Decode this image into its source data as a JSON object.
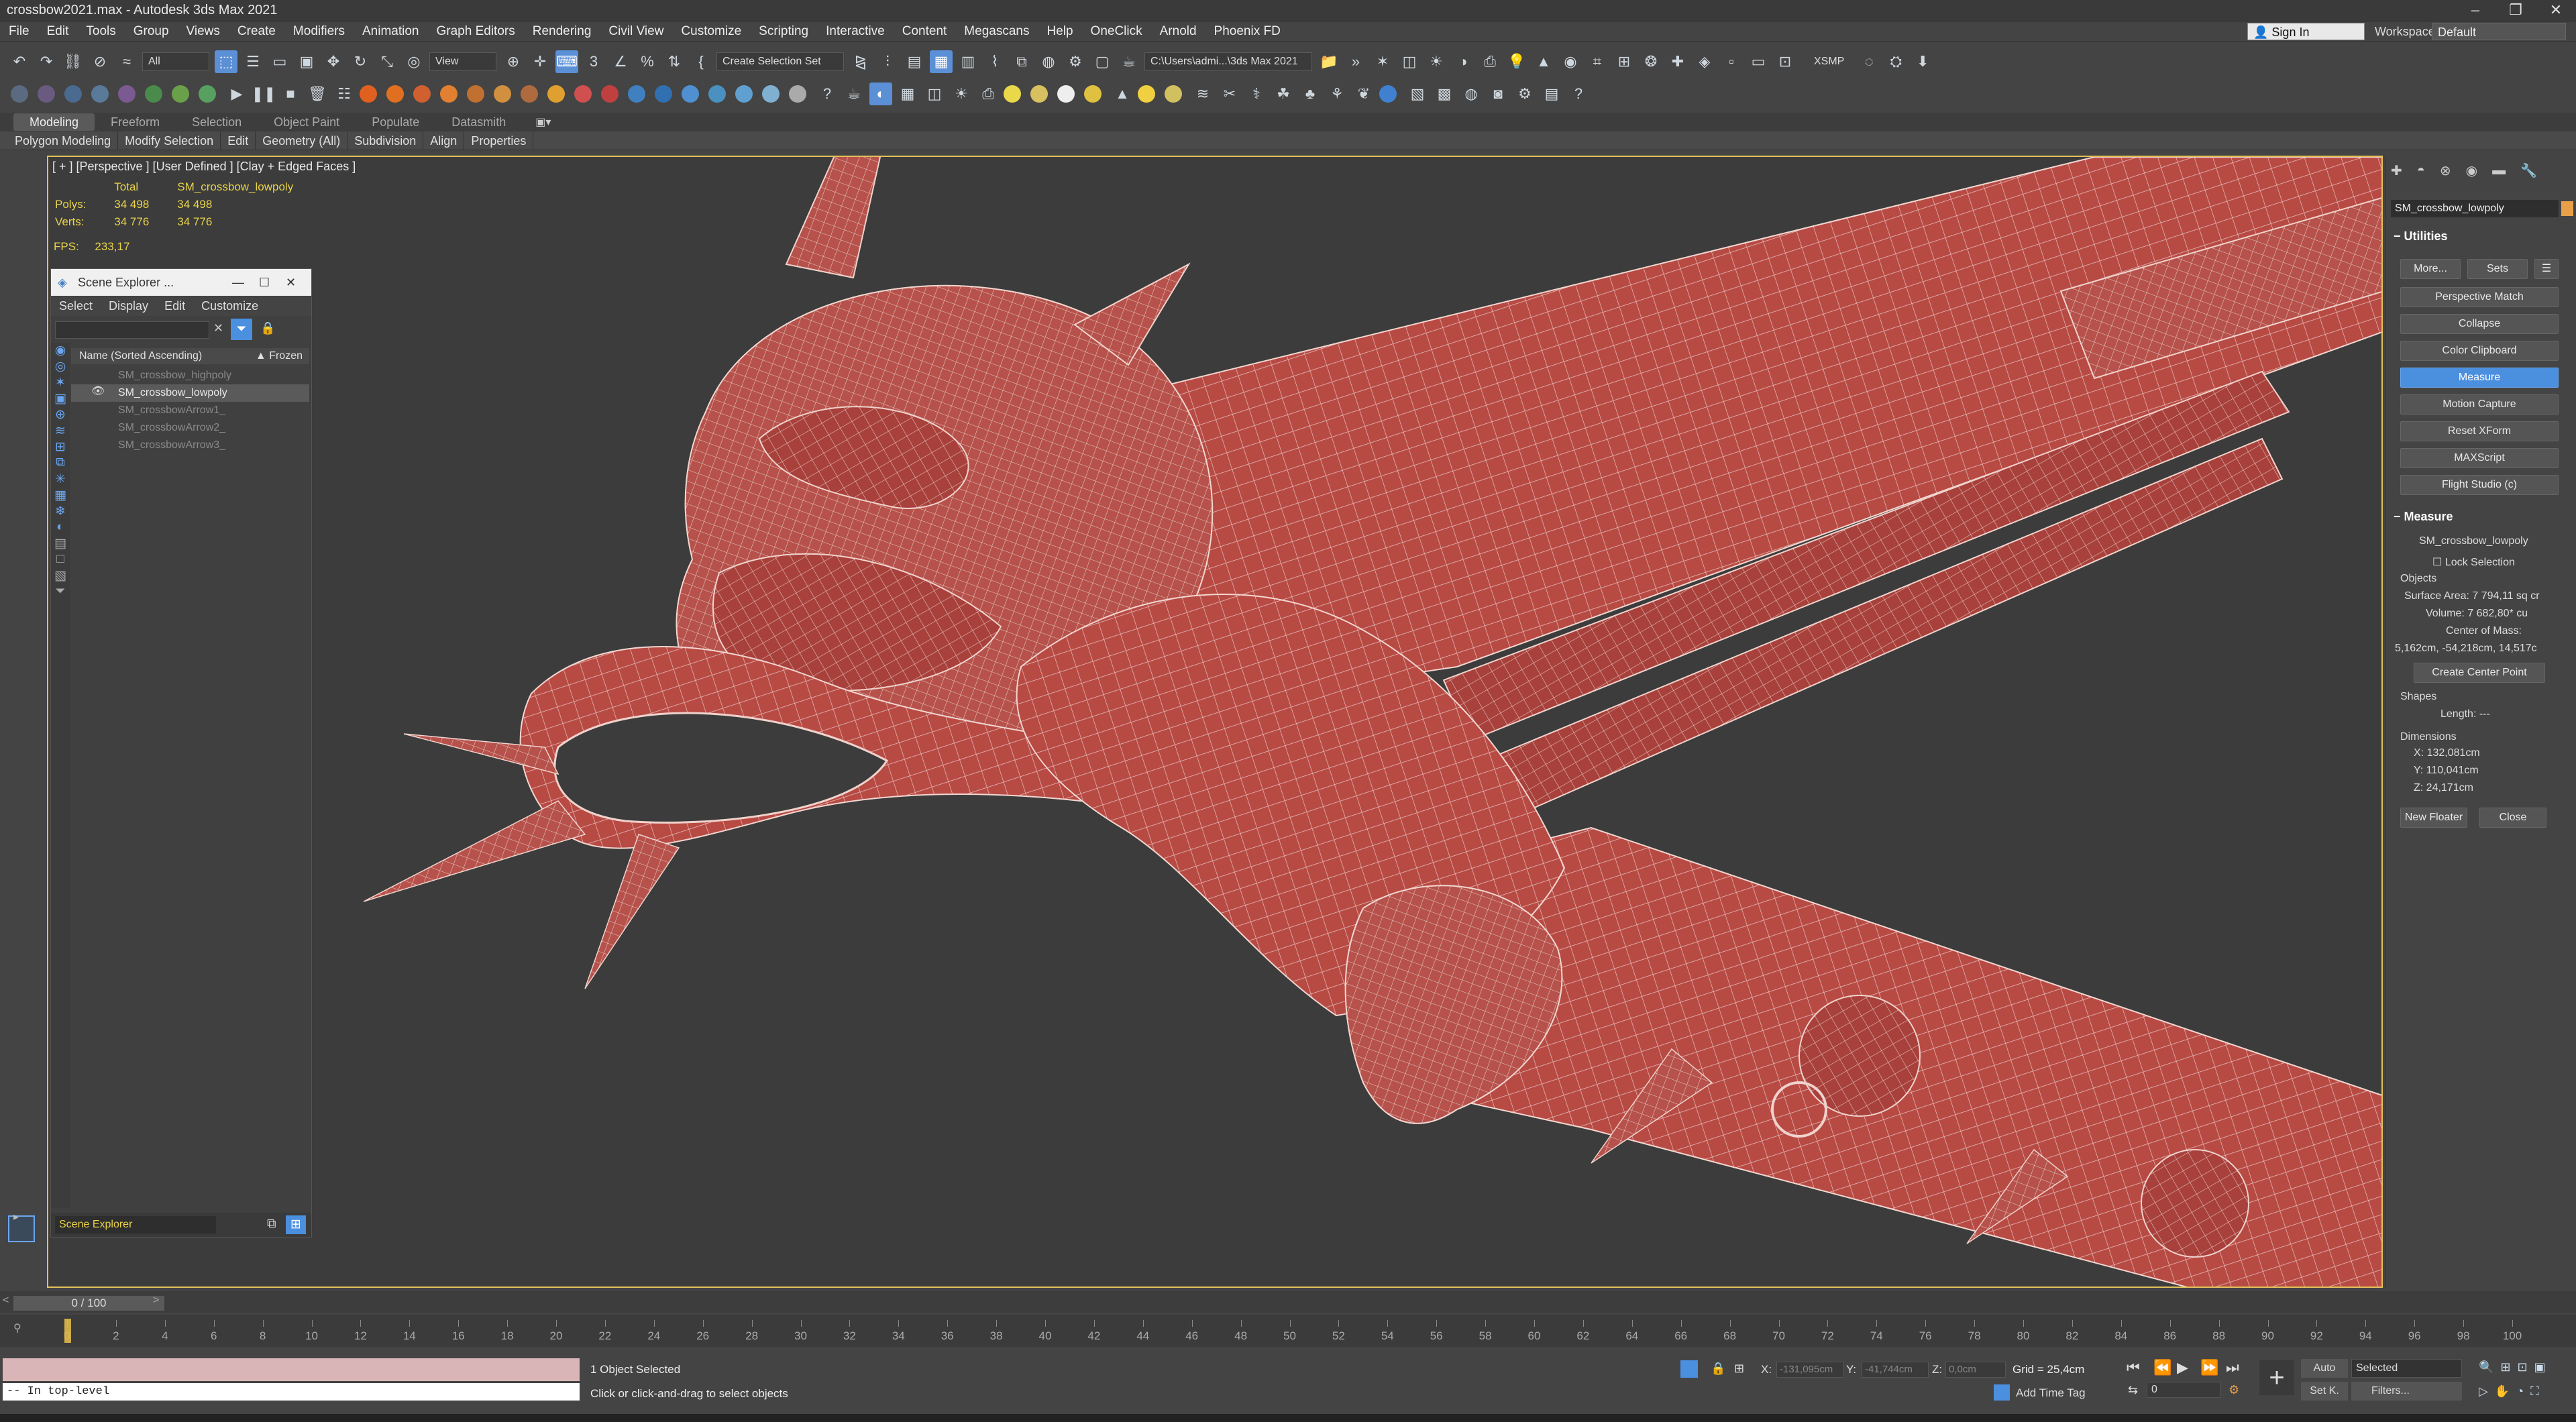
{
  "window": {
    "title": "crossbow2021.max - Autodesk 3ds Max 2021"
  },
  "menu": [
    "File",
    "Edit",
    "Tools",
    "Group",
    "Views",
    "Create",
    "Modifiers",
    "Animation",
    "Graph Editors",
    "Rendering",
    "Civil View",
    "Customize",
    "Scripting",
    "Interactive",
    "Content",
    "Megascans",
    "Help",
    "OneClick",
    "Arnold",
    "Phoenix FD"
  ],
  "account": {
    "signin": "Sign In",
    "workspaces_label": "Workspaces:",
    "workspace": "Default"
  },
  "toolbar": {
    "filter": "All",
    "refcoord": "View",
    "selection_set": "Create Selection Set",
    "project_path": "C:\\Users\\admi...\\3ds Max 2021",
    "xsmp": "XSMP"
  },
  "ribbon": {
    "tabs": [
      "Modeling",
      "Freeform",
      "Selection",
      "Object Paint",
      "Populate",
      "Datasmith"
    ],
    "subtabs": [
      "Polygon Modeling",
      "Modify Selection",
      "Edit",
      "Geometry (All)",
      "Subdivision",
      "Align",
      "Properties"
    ]
  },
  "viewport": {
    "label": "[ + ] [Perspective ] [User Defined ] [Clay + Edged Faces ]",
    "stats": {
      "col_total": "Total",
      "col_object": "SM_crossbow_lowpoly",
      "polys_label": "Polys:",
      "polys_total": "34 498",
      "polys_obj": "34 498",
      "verts_label": "Verts:",
      "verts_total": "34 776",
      "verts_obj": "34 776"
    },
    "fps_label": "FPS:",
    "fps": "233,17",
    "mesh_color": "#b84a44",
    "wire_color": "#e8c9c4"
  },
  "scene_explorer": {
    "title": "Scene Explorer ...",
    "menu": [
      "Select",
      "Display",
      "Edit",
      "Customize"
    ],
    "col_name": "Name (Sorted Ascending)",
    "col_frozen": "▲ Frozen",
    "items": [
      "SM_crossbow_highpoly",
      "SM_crossbow_lowpoly",
      "SM_crossbowArrow1_",
      "SM_crossbowArrow2_",
      "SM_crossbowArrow3_"
    ],
    "selected_index": 1,
    "footer": "Scene Explorer"
  },
  "command_panel": {
    "object_name": "SM_crossbow_lowpoly",
    "utilities_title": "Utilities",
    "more": "More...",
    "sets": "Sets",
    "buttons": [
      "Perspective Match",
      "Collapse",
      "Color Clipboard",
      "Measure",
      "Motion Capture",
      "Reset XForm",
      "MAXScript",
      "Flight Studio (c)"
    ],
    "active_button": "Measure",
    "measure_title": "Measure",
    "measure_object": "SM_crossbow_lowpoly",
    "lock_selection": "Lock Selection",
    "objects_label": "Objects",
    "surface_area": "Surface Area: 7 794,11 sq cr",
    "volume": "Volume:  7 682,80* cu",
    "center_mass_label": "Center of Mass:",
    "center_mass": "5,162cm, -54,218cm, 14,517c",
    "create_center": "Create Center Point",
    "shapes_label": "Shapes",
    "length": "Length:  ---",
    "dimensions_label": "Dimensions",
    "dim_x": "X:   132,081cm",
    "dim_y": "Y:   110,041cm",
    "dim_z": "Z:   24,171cm",
    "new_floater": "New Floater",
    "close": "Close"
  },
  "timeline": {
    "frame": "0 / 100",
    "ticks": [
      0,
      2,
      4,
      6,
      8,
      10,
      12,
      14,
      16,
      18,
      20,
      22,
      24,
      26,
      28,
      30,
      32,
      34,
      36,
      38,
      40,
      42,
      44,
      46,
      48,
      50,
      52,
      54,
      56,
      58,
      60,
      62,
      64,
      66,
      68,
      70,
      72,
      74,
      76,
      78,
      80,
      82,
      84,
      86,
      88,
      90,
      92,
      94,
      96,
      98,
      100
    ]
  },
  "status": {
    "maxscript": "-- In top-level",
    "selected": "1 Object Selected",
    "prompt": "Click or click-and-drag to select objects",
    "x_label": "X:",
    "x": "-131,095cm",
    "y_label": "Y:",
    "y": "-41,744cm",
    "z_label": "Z:",
    "z": "0,0cm",
    "grid": "Grid = 25,4cm",
    "add_time_tag": "Add Time Tag",
    "auto": "Auto",
    "selected_dd": "Selected",
    "setk": "Set K.",
    "filters": "Filters...",
    "frame_field": "0"
  }
}
